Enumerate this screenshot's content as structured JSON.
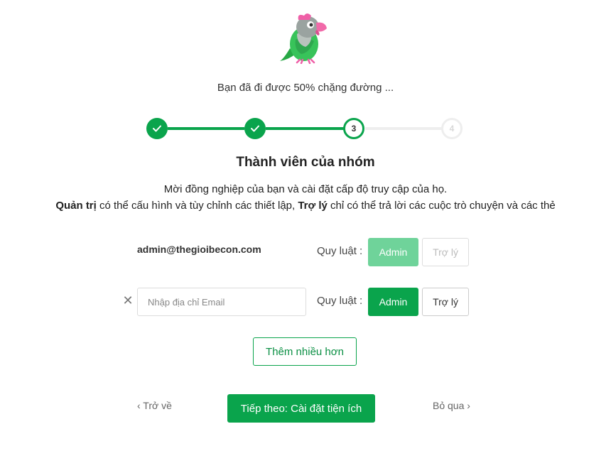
{
  "progress": {
    "text": "Bạn đã đi được 50% chặng đường ...",
    "percent": 50,
    "steps": [
      {
        "label": "",
        "state": "done"
      },
      {
        "label": "",
        "state": "done"
      },
      {
        "label": "3",
        "state": "current"
      },
      {
        "label": "4",
        "state": "todo"
      }
    ]
  },
  "heading": "Thành viên của nhóm",
  "description": {
    "line1": "Mời đồng nghiệp của bạn và cài đặt cấp độ truy cập của họ.",
    "admin_term": "Quản trị",
    "admin_text": " có thể cấu hình và tùy chỉnh các thiết lập, ",
    "supporter_term": "Trợ lý",
    "supporter_text": " chỉ có thể trả lời các cuộc trò chuyện và các thẻ"
  },
  "members": [
    {
      "email": "admin@thegioibecon.com",
      "role_label": "Quy luật :",
      "admin_label": "Admin",
      "supporter_label": "Trợ lý",
      "selected": "Admin",
      "disabled": true
    }
  ],
  "new_member": {
    "email_placeholder": "Nhập địa chỉ Email",
    "email_value": "",
    "role_label": "Quy luật :",
    "admin_label": "Admin",
    "supporter_label": "Trợ lý",
    "selected": "Admin"
  },
  "add_more_label": "Thêm nhiều hơn",
  "nav": {
    "back_label": "‹ Trở về",
    "next_label": "Tiếp theo: Cài đặt tiện ích",
    "skip_label": "Bỏ qua ›"
  },
  "colors": {
    "accent": "#0aa44c",
    "accent_light": "#6fd39a",
    "inactive": "#eeeeee"
  },
  "icons": {
    "mascot": "parrot-mascot-icon",
    "check": "check-icon",
    "remove": "close-icon"
  }
}
